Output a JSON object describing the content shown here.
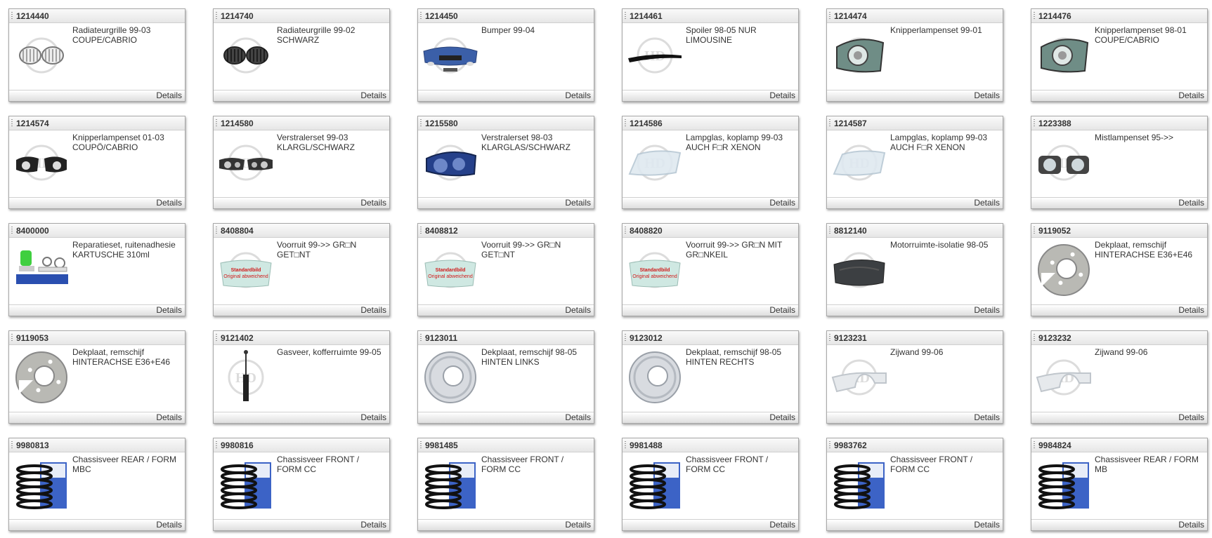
{
  "details_label": "Details",
  "standard_image": {
    "line1": "Standardbild",
    "line2": "Original abweichend"
  },
  "products": [
    {
      "id": "1214440",
      "desc": "Radiateurgrille 99-03\nCOUPE/CABRIO",
      "icon": "grille-chrome-icon"
    },
    {
      "id": "1214740",
      "desc": "Radiateurgrille 99-02\nSCHWARZ",
      "icon": "grille-black-icon"
    },
    {
      "id": "1214450",
      "desc": "Bumper 99-04",
      "icon": "bumper-icon"
    },
    {
      "id": "1214461",
      "desc": "Spoiler 98-05 NUR\nLIMOUSINE",
      "icon": "spoiler-icon"
    },
    {
      "id": "1214474",
      "desc": "Knipperlampenset 99-01",
      "icon": "indicator-lamp-icon"
    },
    {
      "id": "1214476",
      "desc": "Knipperlampenset 98-01\nCOUPE/CABRIO",
      "icon": "indicator-lamp-icon"
    },
    {
      "id": "1214574",
      "desc": "Knipperlampenset 01-03\nCOUPÖ/CABRIO",
      "icon": "indicator-lamp-black-icon"
    },
    {
      "id": "1214580",
      "desc": "Verstralerset 99-03\nKLARGL/SCHWARZ",
      "icon": "headlight-pair-icon"
    },
    {
      "id": "1215580",
      "desc": "Verstralerset 98-03\nKLARGLAS/SCHWARZ",
      "icon": "headlight-blue-icon"
    },
    {
      "id": "1214586",
      "desc": "Lampglas, koplamp 99-03\nAUCH F□R XENON",
      "icon": "lamp-glass-icon"
    },
    {
      "id": "1214587",
      "desc": "Lampglas, koplamp 99-03\nAUCH F□R XENON",
      "icon": "lamp-glass-icon"
    },
    {
      "id": "1223388",
      "desc": "Mistlampenset 95->>",
      "icon": "fog-lamp-icon"
    },
    {
      "id": "8400000",
      "desc": "Reparatieset, ruitenadhesie\nKARTUSCHE 310ml",
      "icon": "repair-kit-icon"
    },
    {
      "id": "8408804",
      "desc": "Voorruit 99->> GR□N\nGET□NT",
      "icon": "windshield-icon"
    },
    {
      "id": "8408812",
      "desc": "Voorruit 99->> GR□N\nGET□NT",
      "icon": "windshield-icon"
    },
    {
      "id": "8408820",
      "desc": "Voorruit 99->> GR□N MIT\nGR□NKEIL",
      "icon": "windshield-icon"
    },
    {
      "id": "8812140",
      "desc": "Motorruimte-isolatie 98-05",
      "icon": "engine-insulation-icon"
    },
    {
      "id": "9119052",
      "desc": "Dekplaat, remschijf\nHINTERACHSE E36+E46",
      "icon": "brake-shield-icon"
    },
    {
      "id": "9119053",
      "desc": "Dekplaat, remschijf\nHINTERACHSE E36+E46",
      "icon": "brake-shield-icon"
    },
    {
      "id": "9121402",
      "desc": "Gasveer, kofferruimte 99-05",
      "icon": "gas-spring-icon"
    },
    {
      "id": "9123011",
      "desc": "Dekplaat, remschijf 98-05\nHINTEN LINKS",
      "icon": "brake-shield-silver-icon"
    },
    {
      "id": "9123012",
      "desc": "Dekplaat, remschijf 98-05\nHINTEN RECHTS",
      "icon": "brake-shield-silver-icon"
    },
    {
      "id": "9123231",
      "desc": "Zijwand 99-06",
      "icon": "side-panel-icon"
    },
    {
      "id": "9123232",
      "desc": "Zijwand 99-06",
      "icon": "side-panel-icon"
    },
    {
      "id": "9980813",
      "desc": "Chassisveer REAR / FORM\nMBC",
      "icon": "coil-spring-icon"
    },
    {
      "id": "9980816",
      "desc": "Chassisveer FRONT /\nFORM CC",
      "icon": "coil-spring-icon"
    },
    {
      "id": "9981485",
      "desc": "Chassisveer FRONT /\nFORM CC",
      "icon": "coil-spring-icon"
    },
    {
      "id": "9981488",
      "desc": "Chassisveer FRONT /\nFORM CC",
      "icon": "coil-spring-icon"
    },
    {
      "id": "9983762",
      "desc": "Chassisveer FRONT /\nFORM CC",
      "icon": "coil-spring-icon"
    },
    {
      "id": "9984824",
      "desc": "Chassisveer REAR / FORM\nMB",
      "icon": "coil-spring-icon"
    }
  ]
}
